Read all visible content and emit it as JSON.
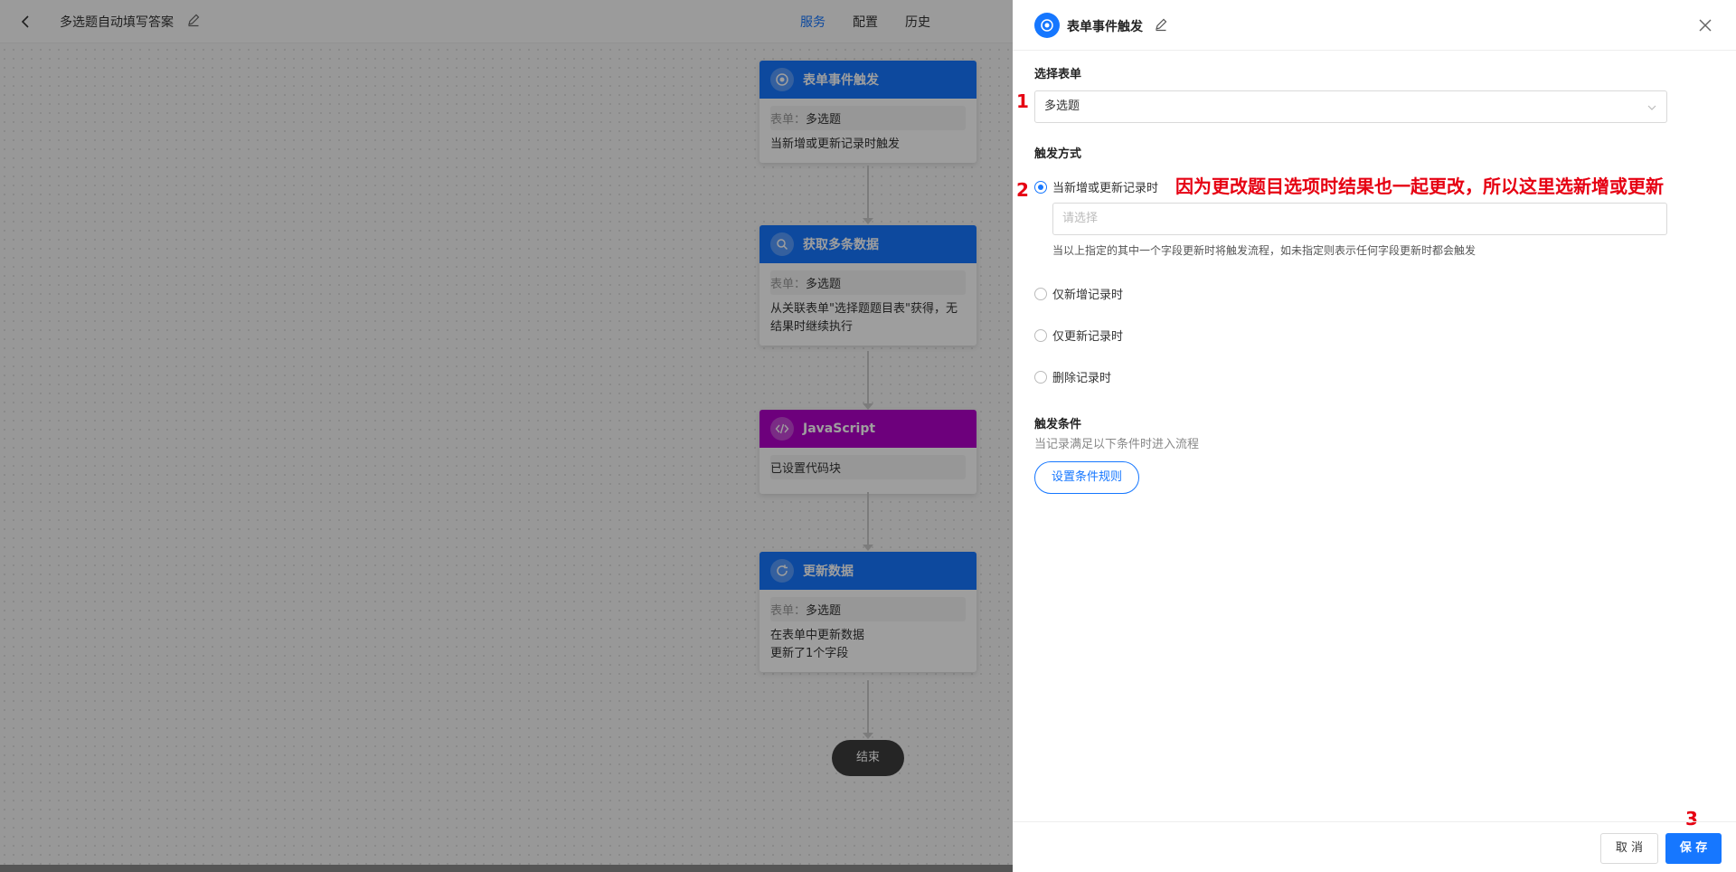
{
  "topbar": {
    "flow_title": "多选题自动填写答案",
    "tabs": [
      {
        "label": "服务",
        "active": true
      },
      {
        "label": "配置",
        "active": false
      },
      {
        "label": "历史",
        "active": false
      }
    ]
  },
  "flow": {
    "nodes": [
      {
        "title": "表单事件触发",
        "color": "#1677ff",
        "icon": "target-icon",
        "form_label": "表单：",
        "form_value": "多选题",
        "desc": "当新增或更新记录时触发"
      },
      {
        "title": "获取多条数据",
        "color": "#1677ff",
        "icon": "search-icon",
        "form_label": "表单：",
        "form_value": "多选题",
        "desc": "从关联表单\"选择题题目表\"获得，无结果时继续执行"
      },
      {
        "title": "JavaScript",
        "color": "#b000c8",
        "icon": "code-icon",
        "desc": "已设置代码块"
      },
      {
        "title": "更新数据",
        "color": "#1677ff",
        "icon": "refresh-icon",
        "form_label": "表单：",
        "form_value": "多选题",
        "desc": "在表单中更新数据",
        "desc2": "更新了1个字段"
      }
    ],
    "end_label": "结束"
  },
  "drawer": {
    "title": "表单事件触发",
    "select_form_label": "选择表单",
    "select_form_value": "多选题",
    "trigger_label": "触发方式",
    "trigger_options": [
      {
        "label": "当新增或更新记录时",
        "checked": true
      },
      {
        "label": "仅新增记录时",
        "checked": false
      },
      {
        "label": "仅更新记录时",
        "checked": false
      },
      {
        "label": "删除记录时",
        "checked": false
      }
    ],
    "field_placeholder": "请选择",
    "field_help": "当以上指定的其中一个字段更新时将触发流程，如未指定则表示任何字段更新时都会触发",
    "condition_label": "触发条件",
    "condition_sub": "当记录满足以下条件时进入流程",
    "condition_button": "设置条件规则",
    "cancel_label": "取 消",
    "save_label": "保 存"
  },
  "annotations": {
    "num1": "1",
    "num2": "2",
    "num3": "3",
    "note": "因为更改题目选项时结果也一起更改，所以这里选新增或更新"
  }
}
